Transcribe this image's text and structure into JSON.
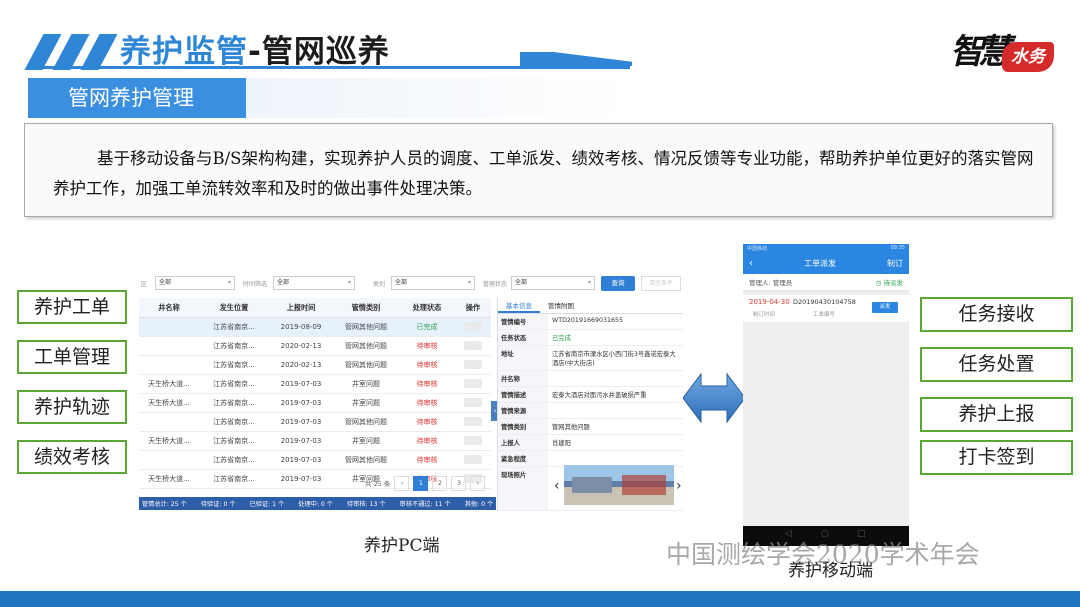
{
  "slide": {
    "title_part1": "养护监管",
    "title_part2": "-管网巡养",
    "logo_text": "智慧",
    "logo_seal": "水务",
    "subtitle": "管网养护管理",
    "description": "基于移动设备与B/S架构构建，实现养护人员的调度、工单派发、绩效考核、情况反馈等专业功能，帮助养护单位更好的落实管网养护工作，加强工单流转效率和及时的做出事件处理决策。",
    "left_features": [
      "养护工单",
      "工单管理",
      "养护轨迹",
      "绩效考核"
    ],
    "right_features": [
      "任务接收",
      "任务处置",
      "养护上报",
      "打卡签到"
    ],
    "pc_caption": "养护PC端",
    "mobile_caption": "养护移动端",
    "watermark": "中国测绘学会2020学术年会"
  },
  "pc": {
    "filters": [
      {
        "label": "区",
        "value": "全部"
      },
      {
        "label": "时间筛选",
        "value": "全部"
      },
      {
        "label": "类别",
        "value": "全部"
      },
      {
        "label": "管理状态",
        "value": "全部"
      }
    ],
    "query_label": "查询",
    "ghost_label": "清空条件",
    "columns": [
      "井名称",
      "发生位置",
      "上报时间",
      "管情类别",
      "处理状态",
      "操作"
    ],
    "rows": [
      {
        "name": "",
        "location": "江苏省南京...",
        "time": "2019-08-09",
        "category": "管网其他问题",
        "status": "已完成"
      },
      {
        "name": "",
        "location": "江苏省南京...",
        "time": "2020-02-13",
        "category": "管网其他问题",
        "status": "待审核"
      },
      {
        "name": "",
        "location": "江苏省南京...",
        "time": "2020-02-13",
        "category": "管网其他问题",
        "status": "待审核"
      },
      {
        "name": "天生桥大道...",
        "location": "江苏省南京...",
        "time": "2019-07-03",
        "category": "井室问题",
        "status": "待审核"
      },
      {
        "name": "天生桥大道...",
        "location": "江苏省南京...",
        "time": "2019-07-03",
        "category": "井室问题",
        "status": "待审核"
      },
      {
        "name": "",
        "location": "江苏省南京...",
        "time": "2019-07-03",
        "category": "管网其他问题",
        "status": "待审核"
      },
      {
        "name": "天生桥大道...",
        "location": "江苏省南京...",
        "time": "2019-07-03",
        "category": "井室问题",
        "status": "待审核"
      },
      {
        "name": "",
        "location": "江苏省南京...",
        "time": "2019-07-03",
        "category": "管网其他问题",
        "status": "待审核"
      },
      {
        "name": "天生桥大道...",
        "location": "江苏省南京...",
        "time": "2019-07-03",
        "category": "井室问题",
        "status": "待审核"
      }
    ],
    "pager": {
      "total": "共 25 条",
      "prev": "‹",
      "pages": [
        "1",
        "2",
        "3"
      ],
      "next": "›"
    },
    "status_bar": [
      "管情总计: 25 个",
      "待验证: 0 个",
      "已验证: 1 个",
      "处理中: 0 个",
      "待审核: 13 个",
      "审核不通过: 11 个",
      "其他: 0 个"
    ],
    "detail": {
      "tabs": [
        "基本信息",
        "管情附图"
      ],
      "fields": [
        {
          "k": "管情编号",
          "v": "WTD20191669031655"
        },
        {
          "k": "任务状态",
          "v": "已完成"
        },
        {
          "k": "地址",
          "v": "江苏省南京市溧水区小西门街3号鑫诺宏泰大酒店(中大街店)"
        },
        {
          "k": "井名称",
          "v": ""
        },
        {
          "k": "管情描述",
          "v": "宏泰大酒店对面污水井盖破损严重"
        },
        {
          "k": "管情来源",
          "v": ""
        },
        {
          "k": "管情类别",
          "v": "管网其他问题"
        },
        {
          "k": "上报人",
          "v": "肖建阳"
        },
        {
          "k": "紧急程度",
          "v": ""
        },
        {
          "k": "现场照片",
          "v": ""
        }
      ]
    }
  },
  "mobile": {
    "status_left": "中国移动",
    "status_right": "09:35",
    "nav_title": "工单派发",
    "nav_action": "制订",
    "assignee": "管理人: 管理员",
    "pick_label": "待派发",
    "card": {
      "date": "2019-04-30",
      "code": "D20190430104758",
      "date_label": "制订时间",
      "code_label": "工单编号",
      "button": "派发"
    }
  },
  "colors": {
    "brand": "#2f86d6",
    "feature_border": "#5aa832",
    "footer": "#1f78bf"
  }
}
